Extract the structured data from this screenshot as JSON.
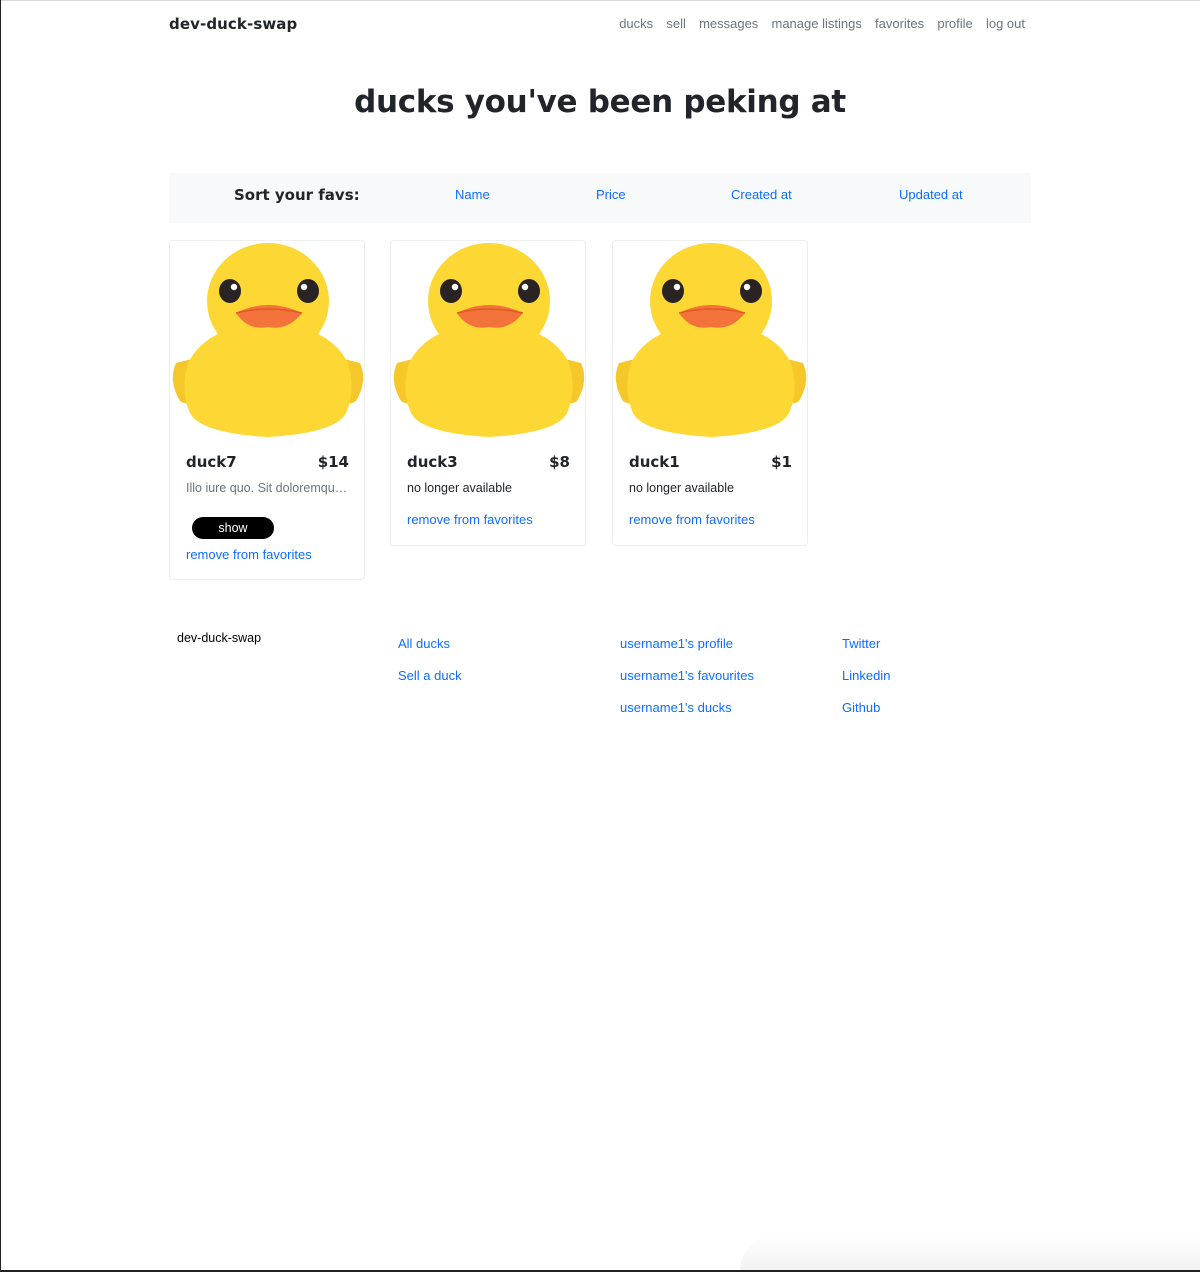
{
  "navbar": {
    "brand": "dev-duck-swap",
    "links": [
      "ducks",
      "sell",
      "messages",
      "manage listings",
      "favorites",
      "profile",
      "log out"
    ]
  },
  "page": {
    "title": "ducks you've been peking at"
  },
  "sort": {
    "label": "Sort your favs:",
    "options": [
      "Name",
      "Price",
      "Created at",
      "Updated at"
    ]
  },
  "cards": [
    {
      "name": "duck7",
      "price": "$14",
      "description": "Illo iure quo. Sit doloremque...",
      "show_label": "show",
      "remove_label": "remove from favorites"
    },
    {
      "name": "duck3",
      "price": "$8",
      "status": "no longer available",
      "remove_label": "remove from favorites"
    },
    {
      "name": "duck1",
      "price": "$1",
      "status": "no longer available",
      "remove_label": "remove from favorites"
    }
  ],
  "footer": {
    "brand": "dev-duck-swap",
    "columns": [
      [
        "All ducks",
        "Sell a duck"
      ],
      [
        "username1's profile",
        "username1's favourites",
        "username1's ducks"
      ],
      [
        "Twitter",
        "Linkedin",
        "Github"
      ]
    ]
  },
  "colors": {
    "link": "#0d6efd",
    "duck_body": "#fdd835",
    "duck_beak": "#f4733a",
    "sortbar_bg": "#f8f9fa"
  }
}
